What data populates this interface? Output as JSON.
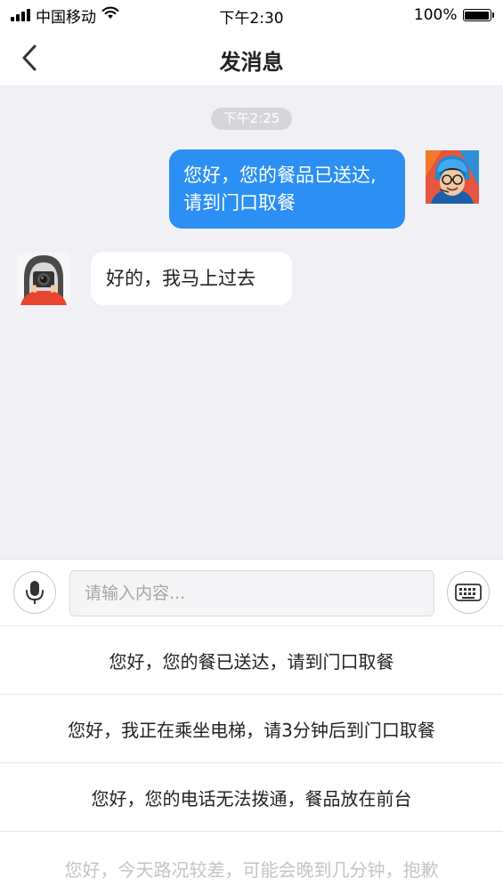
{
  "status_bar": {
    "carrier": "中国移动",
    "time": "下午2:30",
    "battery": "100%"
  },
  "nav": {
    "title": "发消息"
  },
  "chat": {
    "timestamp": "下午2:25",
    "messages": [
      {
        "side": "out",
        "line1": "您好，您的餐品已送达,",
        "line2": "请到门口取餐"
      },
      {
        "side": "in",
        "text": "好的，我马上过去"
      }
    ]
  },
  "input": {
    "placeholder": "请输入内容..."
  },
  "quick_replies": [
    "您好，您的餐已送达，请到门口取餐",
    "您好，我正在乘坐电梯，请3分钟后到门口取餐",
    "您好，您的电话无法拨通，餐品放在前台",
    "您好，今天路况较差，可能会晚到几分钟，抱歉"
  ],
  "colors": {
    "accent": "#2b8ff4",
    "chat_background": "#f1f1f5"
  }
}
